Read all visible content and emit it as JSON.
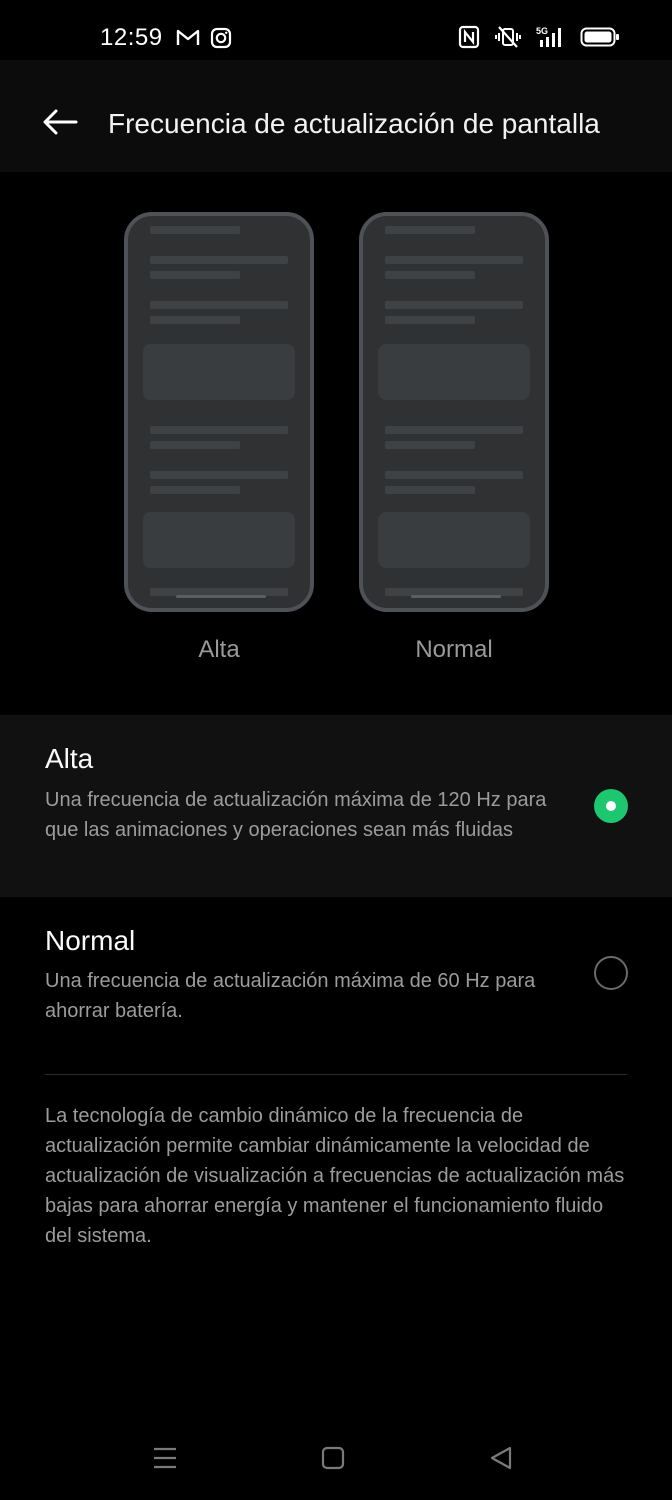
{
  "status_bar": {
    "time": "12:59",
    "network": "5G",
    "left_icons": [
      "gmail-icon",
      "instagram-icon"
    ],
    "right_icons": [
      "nfc-icon",
      "vibrate-mute-icon",
      "signal-5g-icon",
      "battery-icon"
    ]
  },
  "header": {
    "title": "Frecuencia de actualización de pantalla"
  },
  "preview": {
    "left_label": "Alta",
    "right_label": "Normal"
  },
  "options": [
    {
      "title": "Alta",
      "description": "Una frecuencia de actualización máxima de 120 Hz para que las animaciones y operaciones sean más fluidas",
      "selected": true
    },
    {
      "title": "Normal",
      "description": "Una frecuencia de actualización máxima de 60 Hz para ahorrar batería.",
      "selected": false
    }
  ],
  "footer_note": "La tecnología de cambio dinámico de la frecuencia de actualización permite cambiar dinámicamente la velocidad de actualización de visualización a frecuencias de actualización más bajas para ahorrar energía y mantener el funcionamiento fluido del sistema.",
  "colors": {
    "accent": "#1cc76f",
    "background": "#000000",
    "selected_row": "#111111"
  },
  "nav_bar": {
    "icons": [
      "menu-icon",
      "home-square-icon",
      "back-triangle-icon"
    ]
  }
}
